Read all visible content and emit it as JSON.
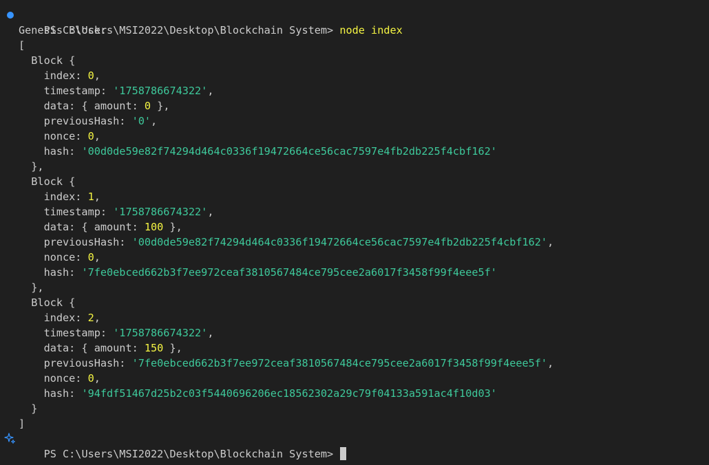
{
  "terminal": {
    "prompt_path": "PS C:\\Users\\MSI2022\\Desktop\\Blockchain System> ",
    "command": "node index",
    "heading": "Genesis Block:",
    "open_bracket": "[",
    "close_bracket": "]",
    "block_label": "  Block {",
    "block_close_comma": "  },",
    "block_close": "  }",
    "keys": {
      "index": "    index: ",
      "timestamp": "    timestamp: ",
      "data_open": "    data: { amount: ",
      "data_close": " },",
      "previousHash": "    previousHash: ",
      "nonce": "    nonce: ",
      "hash": "    hash: "
    },
    "blocks": [
      {
        "index": "0",
        "timestamp": "'1758786674322'",
        "amount": "0",
        "previousHash": "'0'",
        "nonce": "0",
        "hash": "'00d0de59e82f74294d464c0336f19472664ce56cac7597e4fb2db225f4cbf162'"
      },
      {
        "index": "1",
        "timestamp": "'1758786674322'",
        "amount": "100",
        "previousHash": "'00d0de59e82f74294d464c0336f19472664ce56cac7597e4fb2db225f4cbf162'",
        "nonce": "0",
        "hash": "'7fe0ebced662b3f7ee972ceaf3810567484ce795cee2a6017f3458f99f4eee5f'"
      },
      {
        "index": "2",
        "timestamp": "'1758786674322'",
        "amount": "150",
        "previousHash": "'7fe0ebced662b3f7ee972ceaf3810567484ce795cee2a6017f3458f99f4eee5f'",
        "nonce": "0",
        "hash": "'94fdf51467d25b2c03f5440696206ec18562302a29c79f04133a591ac4f10d03'"
      }
    ],
    "colors": {
      "background": "#1f1f1f",
      "text": "#cccccc",
      "command": "#f5f543",
      "number": "#f5f543",
      "string": "#3ec99b",
      "decoration": "#3794ff"
    },
    "icons": {
      "first_prompt": "command-success-dot-icon",
      "last_prompt": "command-sparkle-icon"
    }
  }
}
